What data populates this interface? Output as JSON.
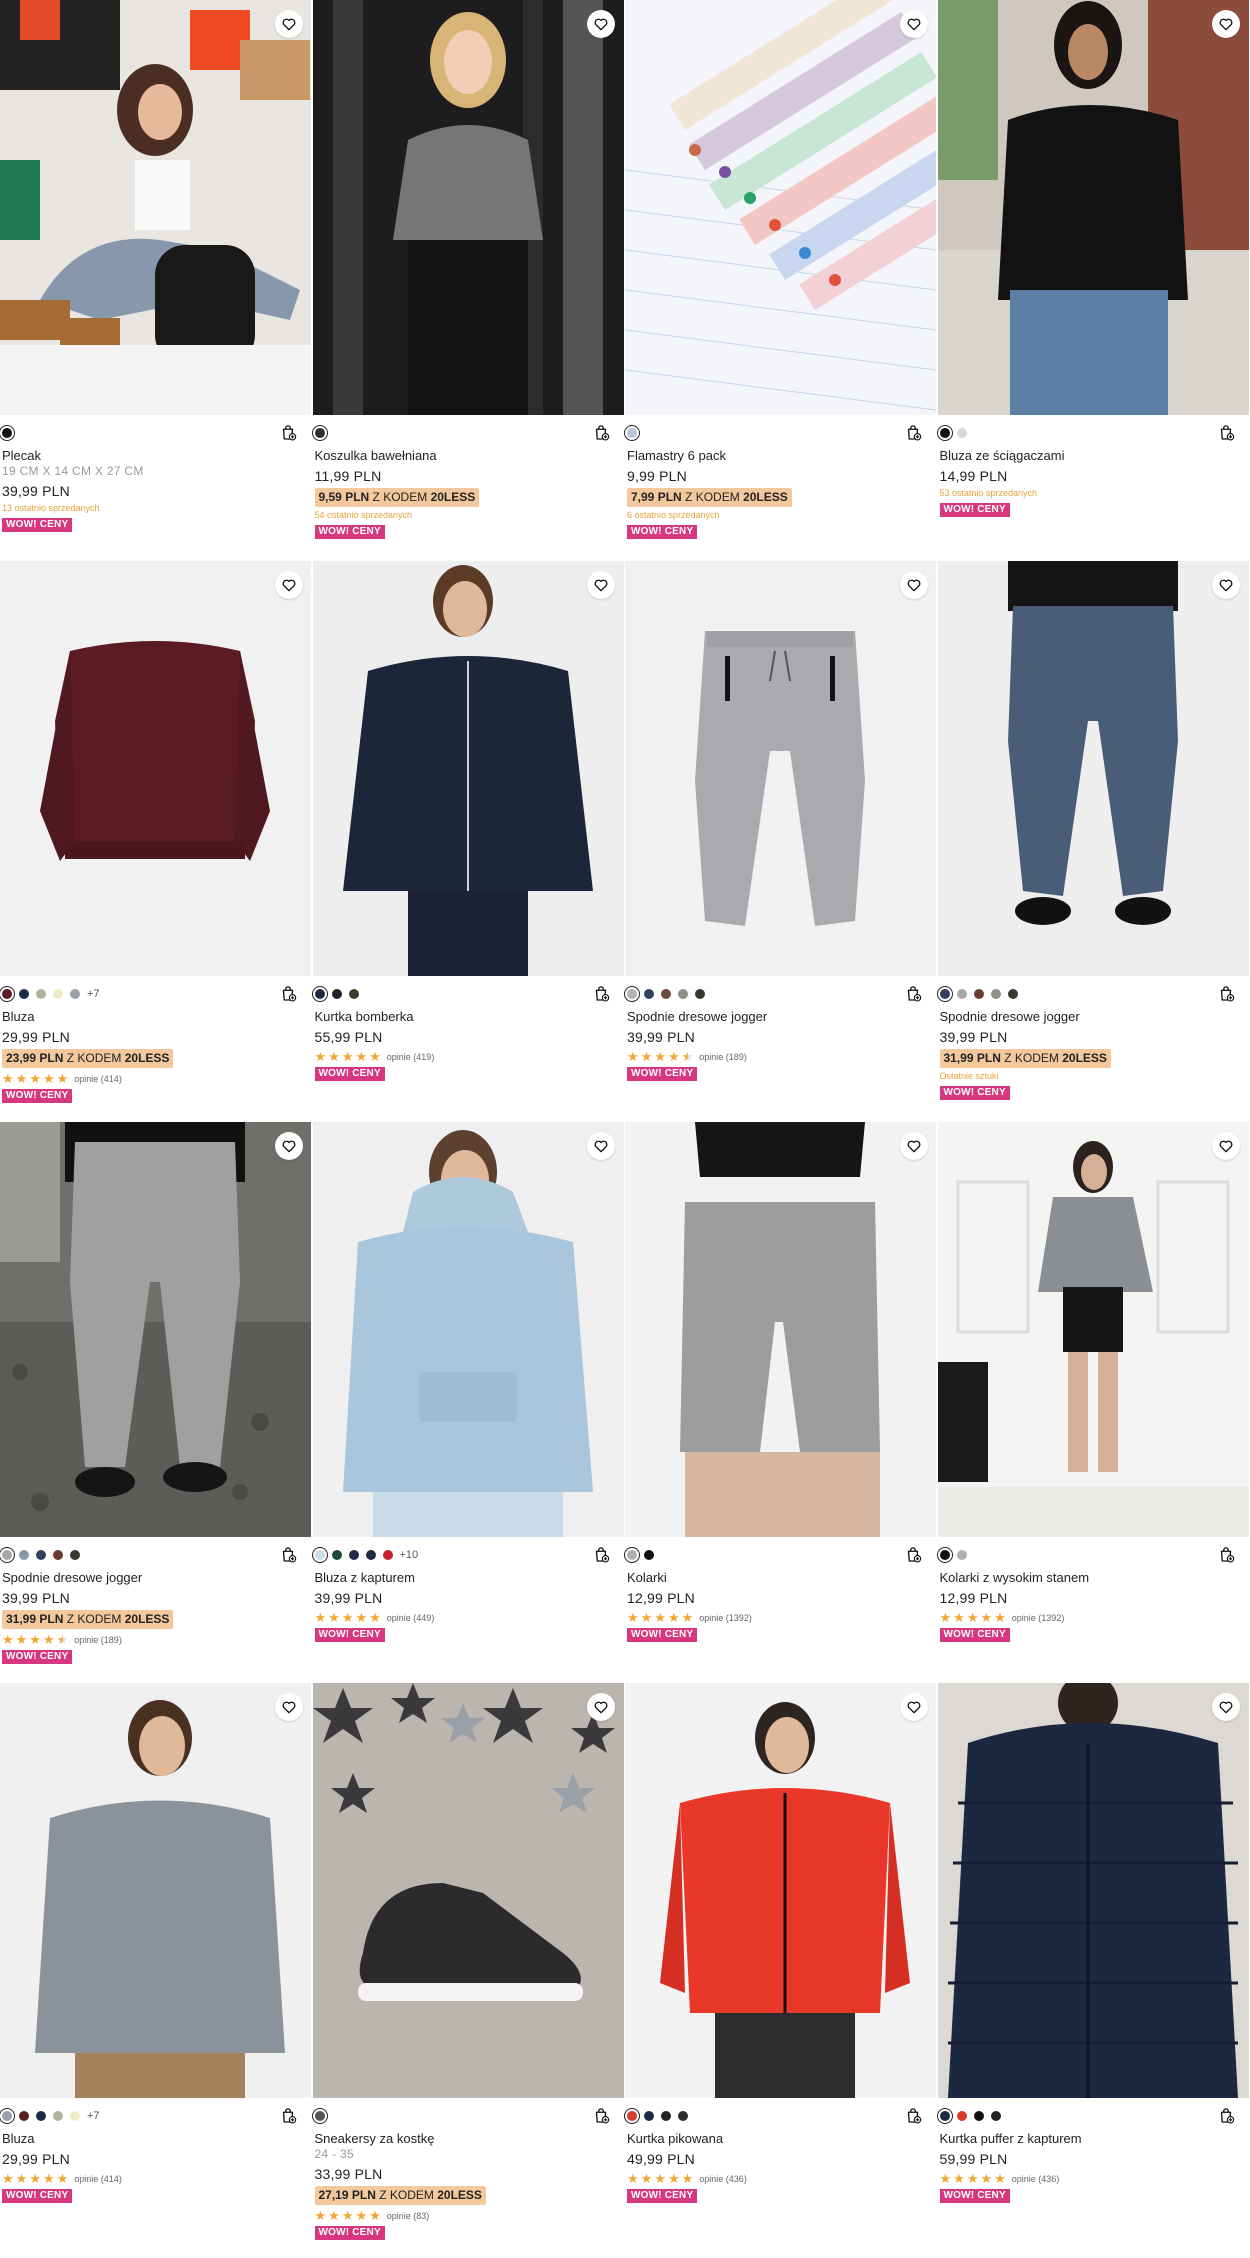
{
  "wow_label": "WOW! CENY",
  "products": [
    {
      "name": "Plecak",
      "sub": "19 CM X 14 CM X 27 CM",
      "price": "39,99 PLN",
      "promo": null,
      "last": "13 ostatnio sprzedanych",
      "rating": null,
      "reviews": null,
      "swatches": [
        "#111111"
      ],
      "more": null
    },
    {
      "name": "Koszulka bawełniana",
      "sub": null,
      "price": "11,99 PLN",
      "promo": {
        "price": "9,59 PLN",
        "text": "Z KODEM",
        "code": "20LESS"
      },
      "last": "54 ostatnio sprzedanych",
      "rating": null,
      "reviews": null,
      "swatches": [
        "#2c2c2c"
      ],
      "more": null
    },
    {
      "name": "Flamastry 6 pack",
      "sub": null,
      "price": "9,99 PLN",
      "promo": {
        "price": "7,99 PLN",
        "text": "Z KODEM",
        "code": "20LESS"
      },
      "last": "6 ostatnio sprzedanych",
      "rating": null,
      "reviews": null,
      "swatches": [
        "#b8c6d8"
      ],
      "more": null
    },
    {
      "name": "Bluza ze ściągaczami",
      "sub": null,
      "price": "14,99 PLN",
      "promo": null,
      "last": "53 ostatnio sprzedanych",
      "rating": null,
      "reviews": null,
      "swatches": [
        "#111111",
        "#d8d8d8"
      ],
      "more": null
    },
    {
      "name": "Bluza",
      "sub": null,
      "price": "29,99 PLN",
      "promo": {
        "price": "23,99 PLN",
        "text": "Z KODEM",
        "code": "20LESS"
      },
      "last": null,
      "rating": 4.8,
      "reviews": "opinie (414)",
      "swatches": [
        "#5a1e22",
        "#1e2b45",
        "#b3b29a",
        "#f3ebc6",
        "#9aa1ab"
      ],
      "more": "+7"
    },
    {
      "name": "Kurtka bomberka",
      "sub": null,
      "price": "55,99 PLN",
      "promo": null,
      "last": null,
      "rating": 4.8,
      "reviews": "opinie (419)",
      "swatches": [
        "#1f2a44",
        "#222222",
        "#3b3f2a"
      ],
      "more": null
    },
    {
      "name": "Spodnie dresowe jogger",
      "sub": null,
      "price": "39,99 PLN",
      "promo": null,
      "last": null,
      "rating": 4.5,
      "reviews": "opinie (189)",
      "swatches": [
        "#b4b4b4",
        "#33415a",
        "#6d4a3a",
        "#8e8e84",
        "#353b2b"
      ],
      "more": null
    },
    {
      "name": "Spodnie dresowe jogger",
      "sub": null,
      "price": "39,99 PLN",
      "promo": {
        "price": "31,99 PLN",
        "text": "Z KODEM",
        "code": "20LESS"
      },
      "last": "Ostatnie sztuki",
      "rating": null,
      "reviews": null,
      "swatches": [
        "#33415a",
        "#a8a8a8",
        "#6d3a30",
        "#8e8e84",
        "#353b2b"
      ],
      "more": null
    },
    {
      "name": "Spodnie dresowe jogger",
      "sub": null,
      "price": "39,99 PLN",
      "promo": {
        "price": "31,99 PLN",
        "text": "Z KODEM",
        "code": "20LESS"
      },
      "last": null,
      "rating": 4.5,
      "reviews": "opinie (189)",
      "swatches": [
        "#a8a8a8",
        "#8a97a8",
        "#33415a",
        "#6d3a30",
        "#353b2b"
      ],
      "more": null
    },
    {
      "name": "Bluza z kapturem",
      "sub": null,
      "price": "39,99 PLN",
      "promo": null,
      "last": null,
      "rating": 4.8,
      "reviews": "opinie (449)",
      "swatches": [
        "#c9dbe8",
        "#1f4a36",
        "#1e2b45",
        "#222a3d",
        "#c4232e"
      ],
      "more": "+10"
    },
    {
      "name": "Kolarki",
      "sub": null,
      "price": "12,99 PLN",
      "promo": null,
      "last": null,
      "rating": 4.8,
      "reviews": "opinie (1392)",
      "swatches": [
        "#b0b0b0",
        "#111111"
      ],
      "more": null
    },
    {
      "name": "Kolarki z wysokim stanem",
      "sub": null,
      "price": "12,99 PLN",
      "promo": null,
      "last": null,
      "rating": 4.8,
      "reviews": "opinie (1392)",
      "swatches": [
        "#111111",
        "#b0b0b0"
      ],
      "more": null
    },
    {
      "name": "Bluza",
      "sub": null,
      "price": "29,99 PLN",
      "promo": null,
      "last": null,
      "rating": 4.8,
      "reviews": "opinie (414)",
      "swatches": [
        "#9aa1ab",
        "#5a1e22",
        "#1e2b45",
        "#b3b29a",
        "#f3ebc6"
      ],
      "more": "+7"
    },
    {
      "name": "Sneakersy za kostkę",
      "sub": "24 - 35",
      "price": "33,99 PLN",
      "promo": {
        "price": "27,19 PLN",
        "text": "Z KODEM",
        "code": "20LESS"
      },
      "last": null,
      "rating": 4.8,
      "reviews": "opinie (83)",
      "swatches": [
        "#555555"
      ],
      "more": null
    },
    {
      "name": "Kurtka pikowana",
      "sub": null,
      "price": "49,99 PLN",
      "promo": null,
      "last": null,
      "rating": 4.8,
      "reviews": "opinie (436)",
      "swatches": [
        "#d63a2a",
        "#1e2b45",
        "#222222",
        "#2b2b2b"
      ],
      "more": null
    },
    {
      "name": "Kurtka puffer z kapturem",
      "sub": null,
      "price": "59,99 PLN",
      "promo": null,
      "last": null,
      "rating": 4.8,
      "reviews": "opinie (436)",
      "swatches": [
        "#1e2b45",
        "#d63a2a",
        "#111111",
        "#222222"
      ],
      "more": null
    }
  ]
}
